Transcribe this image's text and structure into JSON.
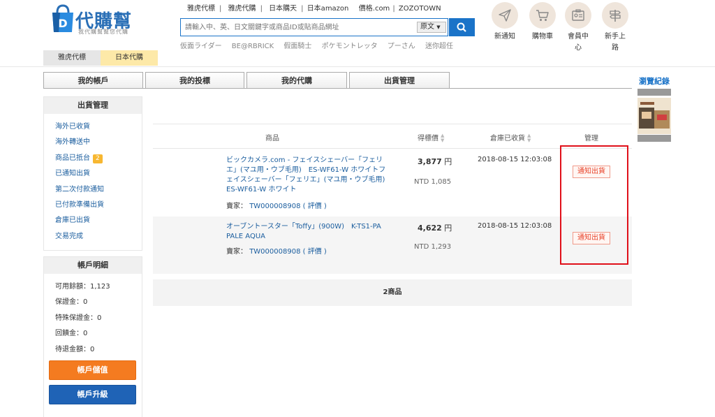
{
  "logo": {
    "title": "代購幫",
    "subtitle": "我代購幫幫您代購",
    "badge_letter": "D"
  },
  "top_links": [
    "雅虎代標",
    "雅虎代購",
    "日本購天",
    "日本amazon",
    "價格.com",
    "ZOZOTOWN"
  ],
  "search": {
    "placeholder": "請輸入中、英、日文關鍵字或商品ID或貼商品網址",
    "language": "原文"
  },
  "hot_keywords": [
    "仮面ライダー",
    "BE@RBRICK",
    "假面騎士",
    "ポケモントレッタ",
    "プーさん",
    "迷你超任"
  ],
  "region_tabs": [
    "雅虎代標",
    "日本代購"
  ],
  "icon_nav": [
    {
      "label": "新通知",
      "icon": "paper-plane-icon"
    },
    {
      "label": "購物車",
      "icon": "cart-icon"
    },
    {
      "label": "會員中心",
      "label_lines": [
        "會員中",
        "心"
      ],
      "icon": "member-card-icon"
    },
    {
      "label": "新手上路",
      "label_lines": [
        "新手上",
        "路"
      ],
      "icon": "signpost-icon"
    }
  ],
  "main_tabs": [
    "我的帳戶",
    "我的投標",
    "我的代購",
    "出貨管理"
  ],
  "sidebar": {
    "shipping": {
      "title": "出貨管理",
      "items": [
        {
          "label": "海外已收貨"
        },
        {
          "label": "海外轉送中"
        },
        {
          "label": "商品已抵台",
          "badge": "2"
        },
        {
          "label": "已通知出貨"
        },
        {
          "label": "第二次付款通知"
        },
        {
          "label": "已付款準備出貨"
        },
        {
          "label": "倉庫已出貨"
        },
        {
          "label": "交易完成"
        }
      ]
    },
    "account": {
      "title": "帳戶明細",
      "items": [
        "可用餘額：1,123",
        "保證金：0",
        "特殊保證金：0",
        "回饋金：0",
        "待退金額：0"
      ],
      "deposit_button": "帳戶儲值",
      "upgrade_button": "帳戶升級"
    }
  },
  "table": {
    "headers": {
      "product": "商品",
      "price": "得標價",
      "received": "倉庫已收貨",
      "manage": "管理"
    },
    "seller_label": "賣家：",
    "rows": [
      {
        "name": "ビックカメラ.com - フェイスシェーバー「フェリエ」(マユ用・ウブ毛用)　ES-WF61-W ホワイトフェイスシェーバー「フェリエ」(マユ用・ウブ毛用)　ES-WF61-W ホワイト",
        "seller": "TW000008908",
        "review": "( 評價 )",
        "price": "3,877",
        "currency": "円",
        "ntd": "NTD 1,085",
        "date": "2018-08-15 12:03:08",
        "action": "通知出貨"
      },
      {
        "name": "オーブントースター「Toffy」(900W)　K-TS1-PA PALE AQUA",
        "seller": "TW000008908",
        "review": "( 評價 )",
        "price": "4,622",
        "currency": "円",
        "ntd": "NTD 1,293",
        "date": "2018-08-15 12:03:08",
        "action": "通知出貨"
      }
    ],
    "summary": "2商品"
  },
  "history": {
    "title": "瀏覽紀錄"
  },
  "colors": {
    "brand_blue": "#1a73c8",
    "orange": "#f47b20",
    "highlight_red": "#e0101a",
    "badge_yellow": "#f7b731"
  }
}
